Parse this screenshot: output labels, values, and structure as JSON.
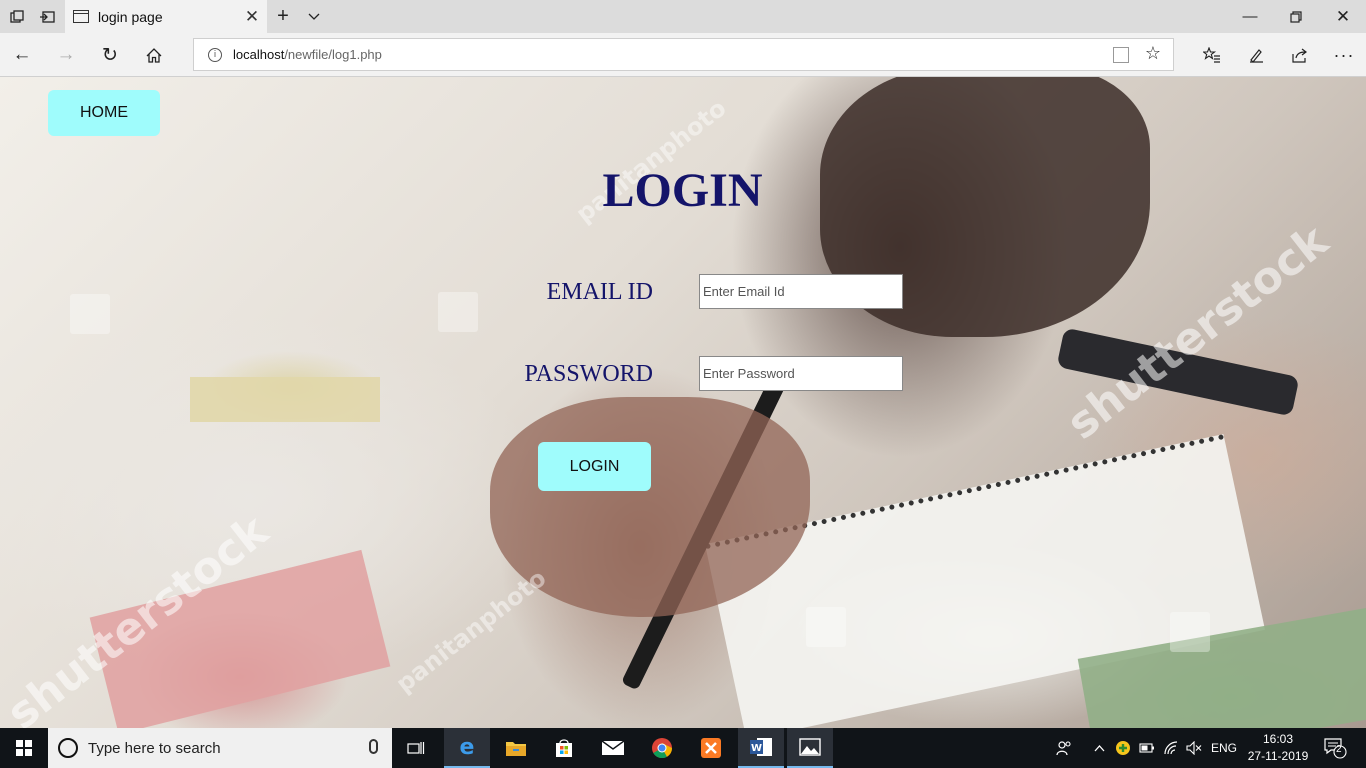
{
  "browser": {
    "tab_title": "login page",
    "url_host": "localhost",
    "url_path": "/newfile/log1.php"
  },
  "page": {
    "home_label": "HOME",
    "title": "LOGIN",
    "email_label": "EMAIL ID",
    "email_placeholder": "Enter Email Id",
    "password_label": "PASSWORD",
    "password_placeholder": "Enter Password",
    "login_button": "LOGIN",
    "button_color": "#9ffcfc",
    "heading_color": "#14146a",
    "watermarks": [
      "shutterstock",
      "panitanphoto"
    ]
  },
  "taskbar": {
    "search_placeholder": "Type here to search",
    "language": "ENG",
    "time": "16:03",
    "date": "27-11-2019",
    "notification_count": "2",
    "apps": [
      "task-view",
      "edge",
      "file-explorer",
      "store",
      "mail",
      "chrome",
      "xampp",
      "word",
      "photos"
    ]
  }
}
